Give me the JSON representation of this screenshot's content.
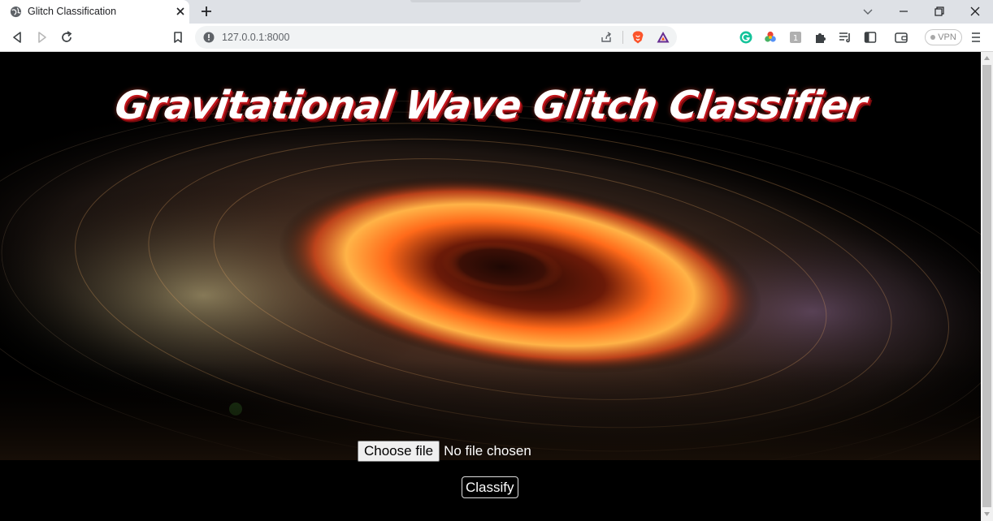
{
  "browser": {
    "tab": {
      "title": "Glitch Classification"
    },
    "address": {
      "url": "127.0.0.1:8000"
    },
    "vpn_label": "VPN"
  },
  "page": {
    "heading": "Gravitational Wave Glitch Classifier",
    "file_input": {
      "button_label": "Choose file",
      "status_text": "No file chosen"
    },
    "classify_label": "Classify"
  },
  "colors": {
    "title_glow": "#c4161c",
    "page_background": "#000000"
  }
}
